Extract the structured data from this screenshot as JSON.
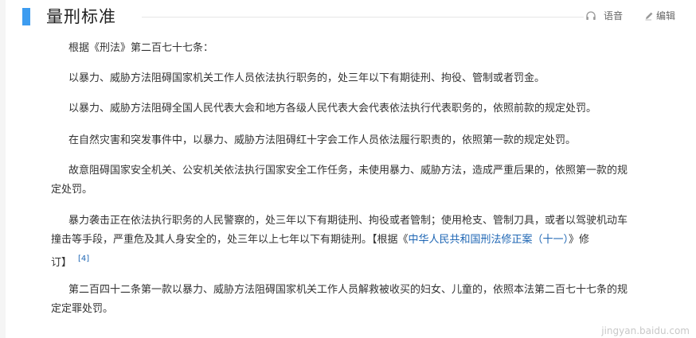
{
  "section": {
    "title": "量刑标准",
    "actions": {
      "voice_label": "语音",
      "edit_label": "编辑"
    }
  },
  "paragraphs": {
    "p1": "根据《刑法》第二百七十七条：",
    "p2": "以暴力、威胁方法阻碍国家机关工作人员依法执行职务的，处三年以下有期徒刑、拘役、管制或者罚金。",
    "p3": "以暴力、威胁方法阻碍全国人民代表大会和地方各级人民代表大会代表依法执行代表职务的，依照前款的规定处罚。",
    "p4": "在自然灾害和突发事件中，以暴力、威胁方法阻碍红十字会工作人员依法履行职责的，依照第一款的规定处罚。",
    "p5_line1": "故意阻碍国家安全机关、公安机关依法执行国家安全工作任务，未使用暴力、威胁方法，造成严重后果的，依照第一款的规",
    "p5_line2": "定处罚。",
    "p6_line1": "暴力袭击正在依法执行职务的人民警察的，处三年以下有期徒刑、拘役或者管制；使用枪支、管制刀具，或者以驾驶机动车",
    "p6_line2_text": "撞击等手段，严重危及其人身安全的，处三年以上七年以下有期徒刑。【根据《",
    "p6_link": "中华人民共和国刑法修正案（十一）",
    "p6_line2_after": "》修",
    "p6_line3": "订】",
    "p6_ref": "[4]",
    "p7_line1": "第二百四十二条第一款以暴力、威胁方法阻碍国家机关工作人员解救被收买的妇女、儿童的，依照本法第二百七十七条的规",
    "p7_line2": "定定罪处罚。"
  },
  "watermark": "jingyan.baidu.com",
  "colors": {
    "accent": "#3d9cf0",
    "link": "#1e66b4",
    "text": "#333333"
  },
  "icons": {
    "voice": "headphones-icon",
    "edit": "pencil-icon"
  }
}
